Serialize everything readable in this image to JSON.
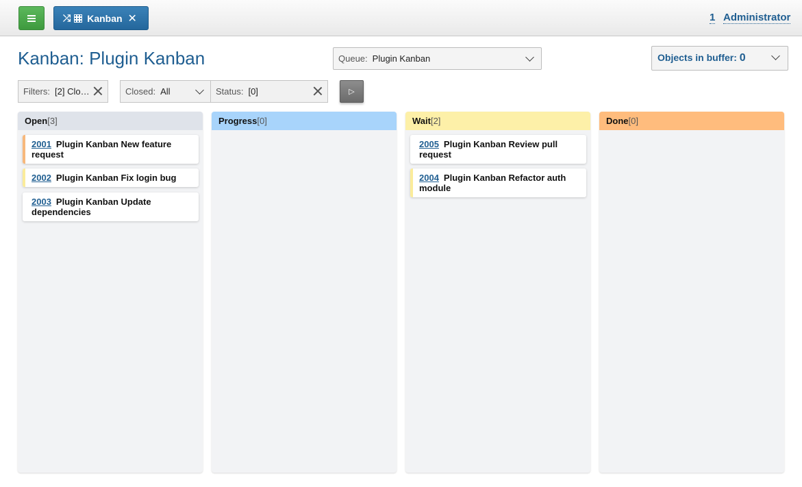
{
  "topbar": {
    "tab_label": "Kanban",
    "user_count": "1",
    "user_name": "Administrator"
  },
  "page": {
    "title": "Kanban: Plugin Kanban"
  },
  "queue": {
    "label": "Queue:",
    "value": "Plugin Kanban"
  },
  "buffer": {
    "label": "Objects in buffer:",
    "count": "0"
  },
  "filters": {
    "filters_label": "Filters:",
    "filters_value": "[2] Clo…",
    "closed_label": "Closed:",
    "closed_value": "All",
    "status_label": "Status:",
    "status_value": "[0]",
    "apply_icon": "▷"
  },
  "columns": [
    {
      "title": "Open",
      "count": "[3]",
      "color": "#dfe3ea",
      "cards": [
        {
          "id": "2001",
          "title": "Plugin Kanban New feature request",
          "accent": "#f7b87c"
        },
        {
          "id": "2002",
          "title": "Plugin Kanban Fix login bug",
          "accent": "#fbec9b"
        },
        {
          "id": "2003",
          "title": "Plugin Kanban Update dependencies",
          "accent": ""
        }
      ]
    },
    {
      "title": "Progress",
      "count": "[0]",
      "color": "#a8d4fb",
      "cards": []
    },
    {
      "title": "Wait",
      "count": "[2]",
      "color": "#fdf0a8",
      "cards": [
        {
          "id": "2005",
          "title": "Plugin Kanban Review pull request",
          "accent": ""
        },
        {
          "id": "2004",
          "title": "Plugin Kanban Refactor auth module",
          "accent": "#fbec9b"
        }
      ]
    },
    {
      "title": "Done",
      "count": "[0]",
      "color": "#ffbc7d",
      "cards": []
    }
  ]
}
